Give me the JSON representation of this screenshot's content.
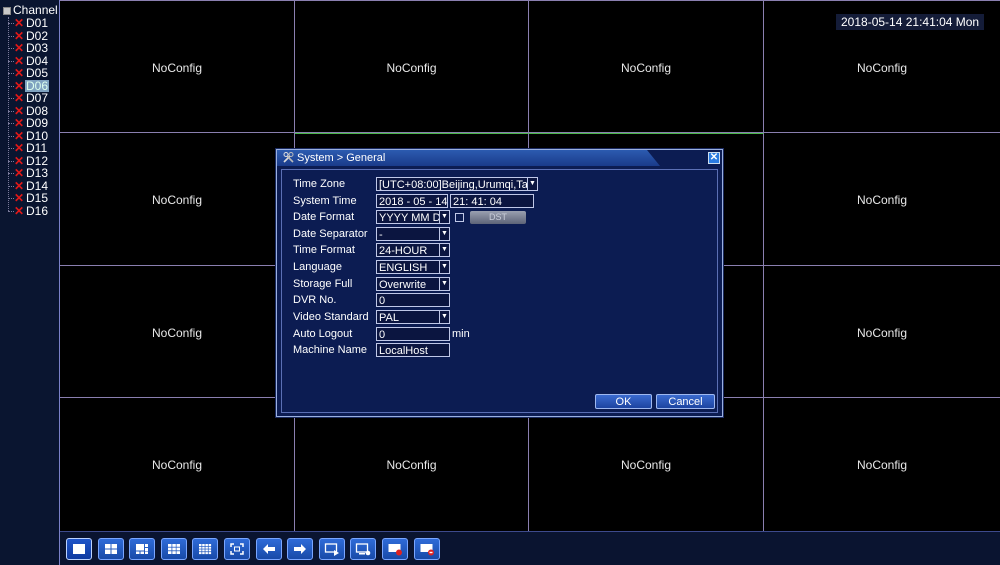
{
  "sidebar": {
    "root_label": "Channel",
    "channels": [
      {
        "label": "D01",
        "selected": false
      },
      {
        "label": "D02",
        "selected": false
      },
      {
        "label": "D03",
        "selected": false
      },
      {
        "label": "D04",
        "selected": false
      },
      {
        "label": "D05",
        "selected": false
      },
      {
        "label": "D06",
        "selected": true
      },
      {
        "label": "D07",
        "selected": false
      },
      {
        "label": "D08",
        "selected": false
      },
      {
        "label": "D09",
        "selected": false
      },
      {
        "label": "D10",
        "selected": false
      },
      {
        "label": "D11",
        "selected": false
      },
      {
        "label": "D12",
        "selected": false
      },
      {
        "label": "D13",
        "selected": false
      },
      {
        "label": "D14",
        "selected": false
      },
      {
        "label": "D15",
        "selected": false
      },
      {
        "label": "D16",
        "selected": false
      }
    ],
    "status_icon": "red-x-icon"
  },
  "grid": {
    "no_config_label": "NoConfig",
    "cells_showing_label": [
      0,
      1,
      2,
      3,
      4,
      7,
      8,
      11,
      12,
      13,
      14,
      15
    ]
  },
  "datetime": "2018-05-14 21:41:04 Mon",
  "dialog": {
    "title": "System > General",
    "title_icon": "tools-icon",
    "close_icon": "close-icon",
    "fields": {
      "time_zone": {
        "label": "Time Zone",
        "value": "[UTC+08:00]Beijing,Urumqi,Ta"
      },
      "system_time": {
        "label": "System Time",
        "date": "2018 - 05 - 14",
        "time": "21: 41: 04"
      },
      "date_format": {
        "label": "Date Format",
        "value": "YYYY MM DD",
        "dst_label": "DST"
      },
      "date_separator": {
        "label": "Date Separator",
        "value": "-"
      },
      "time_format": {
        "label": "Time Format",
        "value": "24-HOUR"
      },
      "language": {
        "label": "Language",
        "value": "ENGLISH"
      },
      "storage_full": {
        "label": "Storage Full",
        "value": "Overwrite"
      },
      "dvr_no": {
        "label": "DVR No.",
        "value": "0"
      },
      "video_standard": {
        "label": "Video Standard",
        "value": "PAL"
      },
      "auto_logout": {
        "label": "Auto Logout",
        "value": "0",
        "unit": "min"
      },
      "machine_name": {
        "label": "Machine Name",
        "value": "LocalHost"
      }
    },
    "ok_label": "OK",
    "cancel_label": "Cancel"
  },
  "toolbar": {
    "buttons": [
      "single-view-icon",
      "quad-view-icon",
      "six-view-icon",
      "nine-view-icon",
      "sixteen-view-icon",
      "fullscreen-icon",
      "previous-icon",
      "next-icon",
      "playback-icon",
      "record-icon",
      "start-record-icon",
      "stop-record-icon"
    ]
  }
}
